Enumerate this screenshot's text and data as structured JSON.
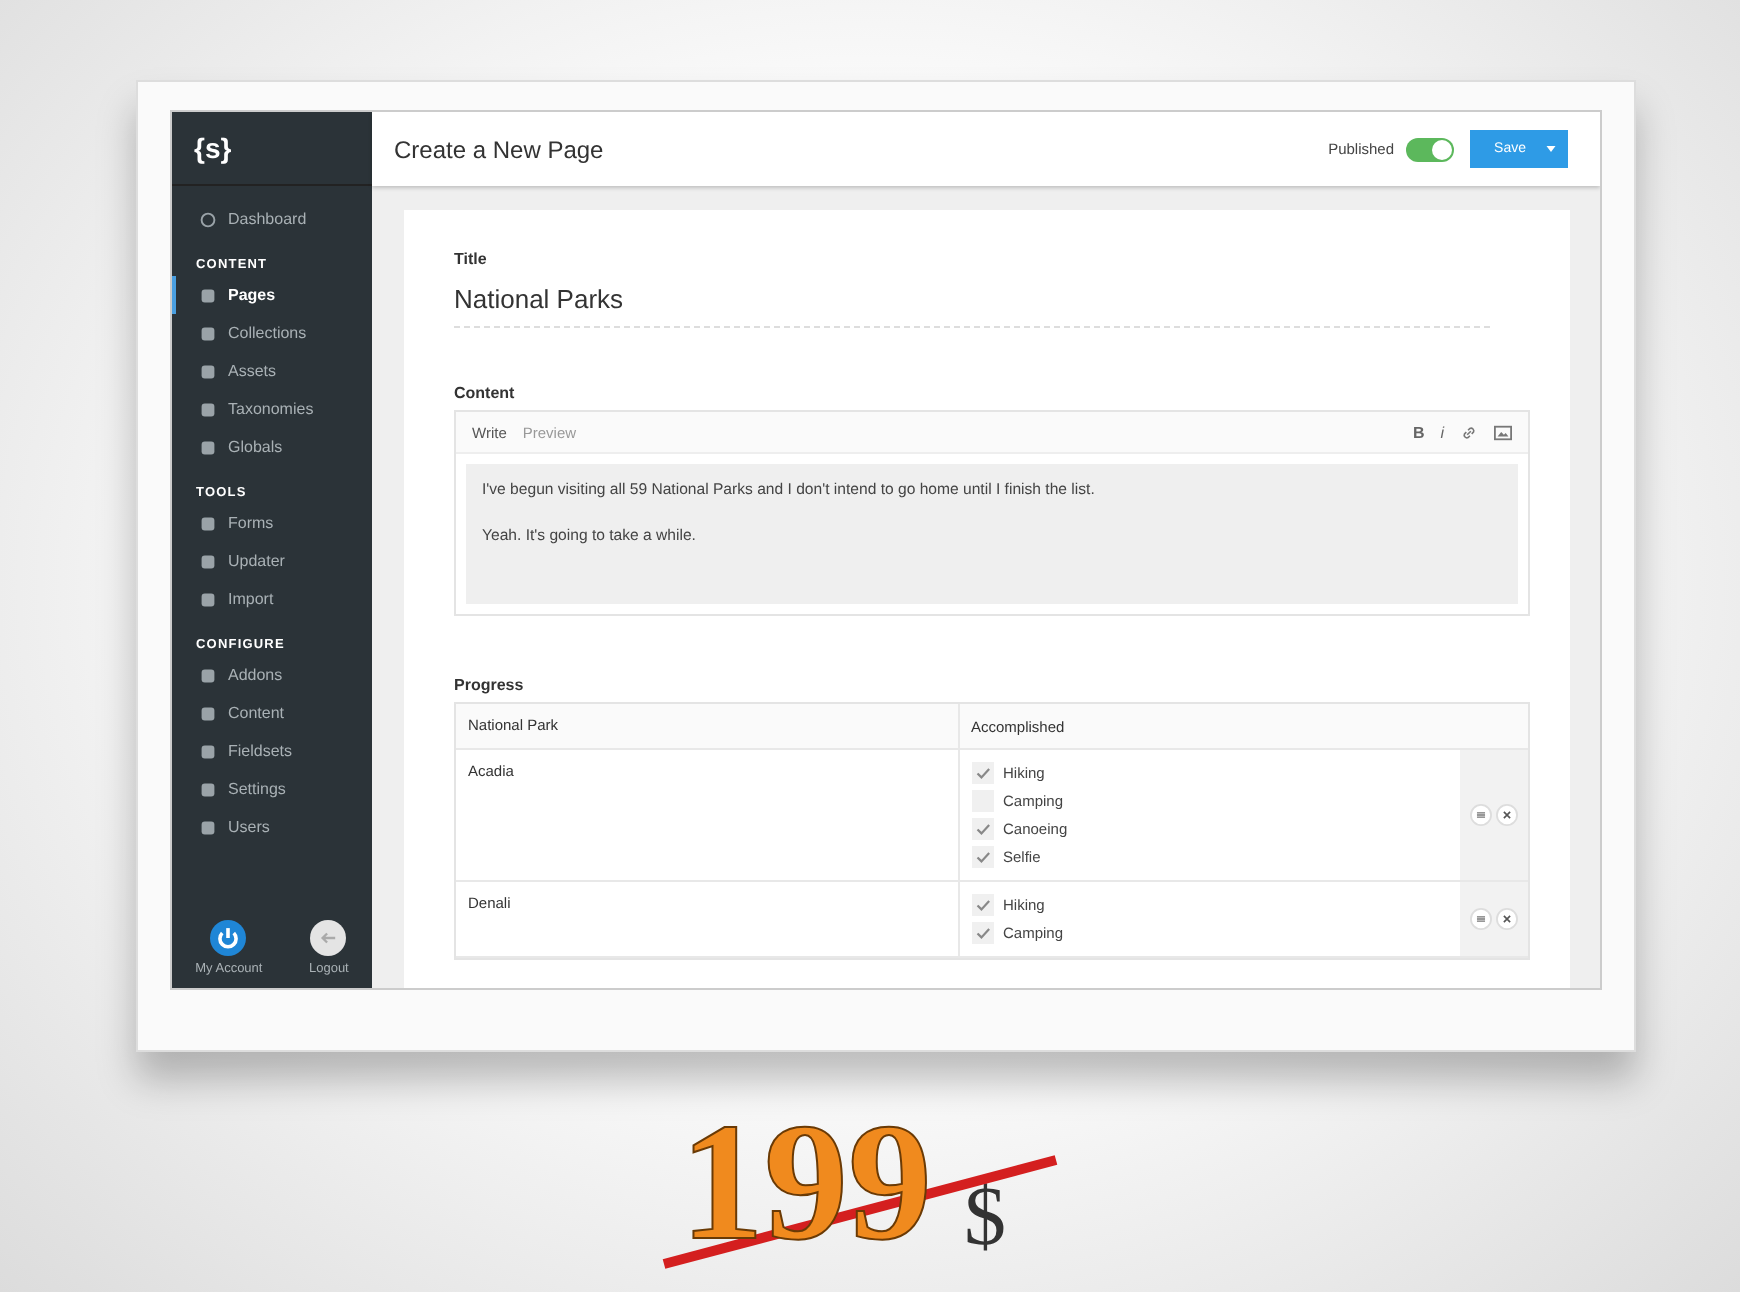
{
  "sidebar": {
    "logo": "{s}",
    "top_item": {
      "label": "Dashboard",
      "selected": false
    },
    "sections": [
      {
        "heading": "CONTENT",
        "items": [
          {
            "label": "Pages",
            "selected": true
          },
          {
            "label": "Collections",
            "selected": false
          },
          {
            "label": "Assets",
            "selected": false
          },
          {
            "label": "Taxonomies",
            "selected": false
          },
          {
            "label": "Globals",
            "selected": false
          }
        ]
      },
      {
        "heading": "TOOLS",
        "items": [
          {
            "label": "Forms",
            "selected": false
          },
          {
            "label": "Updater",
            "selected": false
          },
          {
            "label": "Import",
            "selected": false
          }
        ]
      },
      {
        "heading": "CONFIGURE",
        "items": [
          {
            "label": "Addons",
            "selected": false
          },
          {
            "label": "Content",
            "selected": false
          },
          {
            "label": "Fieldsets",
            "selected": false
          },
          {
            "label": "Settings",
            "selected": false
          },
          {
            "label": "Users",
            "selected": false
          }
        ]
      }
    ],
    "footer": [
      {
        "label": "My Account",
        "kind": "power"
      },
      {
        "label": "Logout",
        "kind": "back"
      }
    ]
  },
  "header": {
    "title": "Create a New Page",
    "published": {
      "label": "Published",
      "on": true
    },
    "save_button": "Save"
  },
  "form": {
    "title_field": {
      "label": "Title",
      "value": "National Parks"
    },
    "content_field": {
      "label": "Content",
      "tabs": [
        {
          "label": "Write",
          "selected": true
        },
        {
          "label": "Preview",
          "selected": false
        }
      ],
      "toolbar": [
        "B",
        "i"
      ],
      "paragraphs": [
        "I've begun visiting all 59 National Parks and I don't intend to go home until I finish the list.",
        "Yeah. It's going to take a while."
      ]
    },
    "progress": {
      "label": "Progress",
      "columns": [
        "National Park",
        "Accomplished"
      ],
      "rows": [
        {
          "park": "Acadia",
          "items": [
            {
              "label": "Hiking",
              "checked": true
            },
            {
              "label": "Camping",
              "checked": false
            },
            {
              "label": "Canoeing",
              "checked": true
            },
            {
              "label": "Selfie",
              "checked": true
            }
          ]
        },
        {
          "park": "Denali",
          "items": [
            {
              "label": "Hiking",
              "checked": true
            },
            {
              "label": "Camping",
              "checked": true
            }
          ]
        }
      ]
    }
  },
  "price": {
    "amount": "199",
    "currency": "$",
    "struck": true
  }
}
